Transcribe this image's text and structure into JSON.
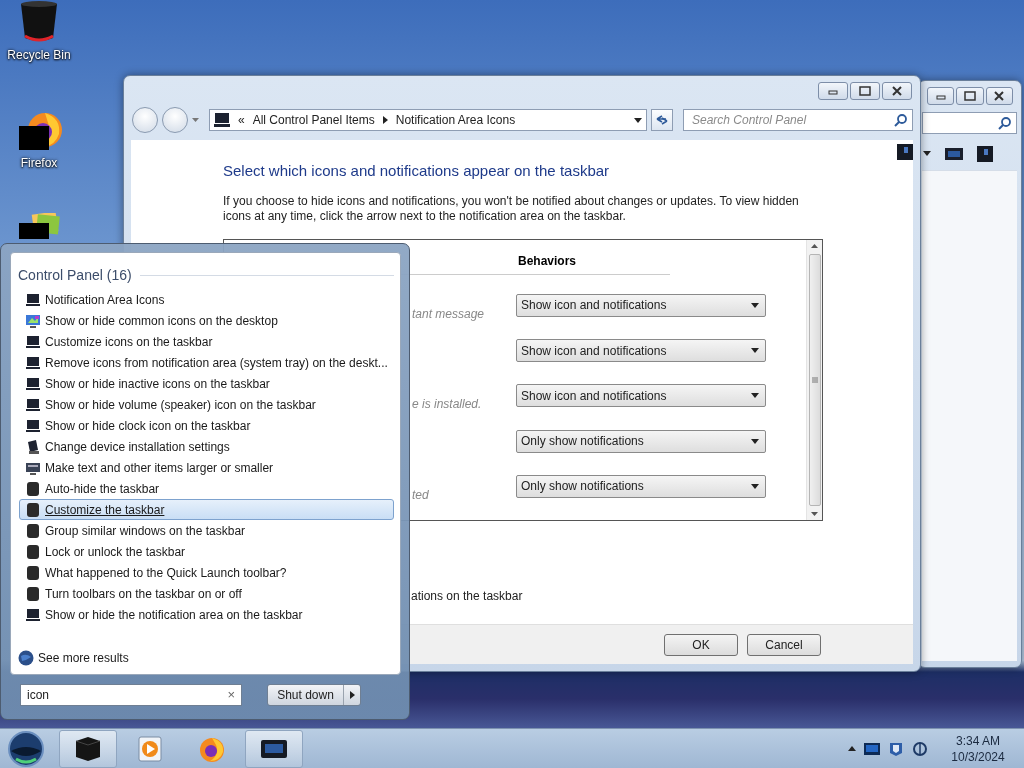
{
  "desktop_icons": [
    {
      "kind": "bin",
      "label": "Recycle Bin"
    },
    {
      "kind": "firefox",
      "label": "Firefox"
    },
    {
      "kind": "folder"
    }
  ],
  "window": {
    "address": {
      "overflow": "«",
      "crumbs": [
        "All Control Panel Items",
        "Notification Area Icons"
      ]
    },
    "search": {
      "placeholder": "Search Control Panel"
    },
    "heading": "Select which icons and notifications appear on the taskbar",
    "description": "If you choose to hide icons and notifications, you won't be notified about changes or updates. To view hidden icons at any time, click the arrow next to the notification area on the taskbar.",
    "behaviors_header": "Behaviors",
    "rows": [
      {
        "fragment": "tant message",
        "behavior": "Show icon and notifications"
      },
      {
        "behavior": "Show icon and notifications"
      },
      {
        "fragment": "e is installed.",
        "behavior": "Show icon and notifications"
      },
      {
        "behavior": "Only show notifications"
      },
      {
        "fragment": "ted",
        "behavior": "Only show notifications"
      }
    ],
    "footer_fragment": "ations on the taskbar",
    "buttons": [
      "OK",
      "Cancel"
    ]
  },
  "start_menu": {
    "group_title": "Control Panel (16)",
    "results": [
      {
        "kind": "monitor",
        "label": "Notification Area Icons",
        "selected": false
      },
      {
        "kind": "desktop",
        "label": "Show or hide common icons on the desktop",
        "selected": false
      },
      {
        "kind": "monitor",
        "label": "Customize icons on the taskbar",
        "selected": false
      },
      {
        "kind": "monitor",
        "label": "Remove icons from notification area (system tray) on the deskt...",
        "selected": false
      },
      {
        "kind": "monitor",
        "label": "Show or hide inactive icons on the taskbar",
        "selected": false
      },
      {
        "kind": "monitor",
        "label": "Show or hide volume (speaker) icon on the taskbar",
        "selected": false
      },
      {
        "kind": "monitor",
        "label": "Show or hide clock icon on the taskbar",
        "selected": false
      },
      {
        "kind": "device",
        "label": "Change device installation settings",
        "selected": false
      },
      {
        "kind": "display",
        "label": "Make text and other items larger or smaller",
        "selected": false
      },
      {
        "kind": "taskbar",
        "label": "Auto-hide the taskbar",
        "selected": false
      },
      {
        "kind": "taskbar",
        "label": "Customize the taskbar",
        "selected": true
      },
      {
        "kind": "taskbar",
        "label": "Group similar windows on the taskbar",
        "selected": false
      },
      {
        "kind": "taskbar",
        "label": "Lock or unlock the taskbar",
        "selected": false
      },
      {
        "kind": "taskbar",
        "label": "What happened to the Quick Launch toolbar?",
        "selected": false
      },
      {
        "kind": "taskbar",
        "label": "Turn toolbars on the taskbar on or off",
        "selected": false
      },
      {
        "kind": "monitor",
        "label": "Show or hide the notification area on the taskbar",
        "selected": false
      }
    ],
    "see_more": "See more results",
    "search": {
      "value": "icon",
      "clear": "×"
    },
    "shutdown": "Shut down"
  },
  "taskbar": {
    "apps": [
      {
        "kind": "explorer",
        "open": true
      },
      {
        "kind": "media",
        "open": false
      },
      {
        "kind": "firefox",
        "open": false
      },
      {
        "kind": "monitor",
        "open": true
      }
    ],
    "clock": {
      "time": "3:34 AM",
      "date": "10/3/2024"
    }
  }
}
